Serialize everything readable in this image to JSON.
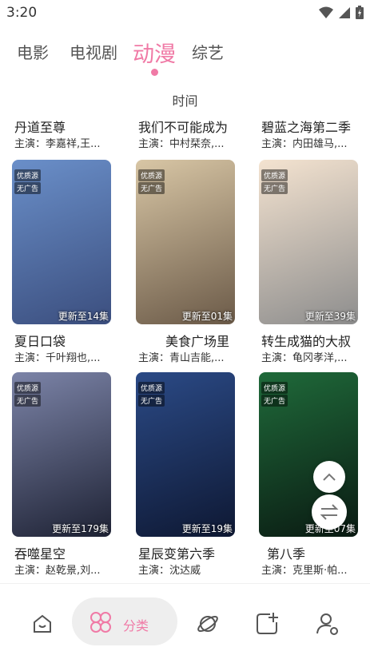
{
  "status_bar": {
    "time": "3:20"
  },
  "tabs": [
    {
      "label": "电影",
      "active": false
    },
    {
      "label": "电视剧",
      "active": false
    },
    {
      "label": "动漫",
      "active": true
    },
    {
      "label": "综艺",
      "active": false
    }
  ],
  "sort_label": "时间",
  "top_row": [
    {
      "title": "丹道至尊",
      "cast": "主演：李嘉祥,王..."
    },
    {
      "title": "我们不可能成为",
      "cast": "主演：中村栞奈,..."
    },
    {
      "title": "碧蓝之海第二季",
      "cast": "主演：内田雄马,..."
    }
  ],
  "cards_row1": [
    {
      "title": "夏日口袋",
      "cast": "主演：千叶翔也,...",
      "badge1": "优质源",
      "badge2": "无广告",
      "episodes": "更新至14集",
      "colors": [
        "#6a8fc9",
        "#3b4e7e"
      ]
    },
    {
      "title": "美食广场里",
      "cast": "主演：青山吉能,...",
      "badge1": "优质源",
      "badge2": "无广告",
      "episodes": "更新至01集",
      "colors": [
        "#d8c6a5",
        "#6b5a48"
      ]
    },
    {
      "title": "转生成猫的大叔",
      "cast": "主演：龟冈孝洋,...",
      "badge1": "优质源",
      "badge2": "无广告",
      "episodes": "更新至39集",
      "colors": [
        "#f4e3d0",
        "#8d8d8d"
      ]
    }
  ],
  "cards_row2": [
    {
      "title": "吞噬星空",
      "cast": "主演：赵乾景,刘...",
      "badge1": "优质源",
      "badge2": "无广告",
      "episodes": "更新至179集",
      "colors": [
        "#7c84a8",
        "#1e2234"
      ]
    },
    {
      "title": "星辰变第六季",
      "cast": "主演：沈达威",
      "badge1": "优质源",
      "badge2": "无广告",
      "episodes": "更新至19集",
      "colors": [
        "#2b4a86",
        "#0e1833"
      ]
    },
    {
      "title": "第八季",
      "cast": "主演：克里斯·帕...",
      "badge1": "优质源",
      "badge2": "无广告",
      "episodes": "更新至07集",
      "colors": [
        "#1f6a3a",
        "#0a1a12"
      ]
    }
  ],
  "nav": {
    "active_label": "分类"
  },
  "colors": {
    "accent": "#f07aa6"
  }
}
